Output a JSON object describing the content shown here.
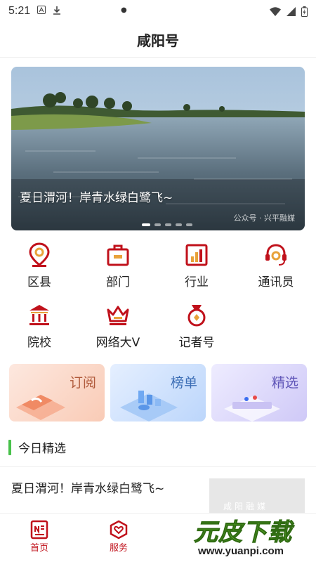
{
  "status_bar": {
    "time": "5:21"
  },
  "header": {
    "title": "咸阳号"
  },
  "banner": {
    "caption": "夏日渭河！岸青水绿白鹭飞~",
    "source_watermark": "公众号 · 兴平融媒",
    "page_count": 5,
    "active_page": 1
  },
  "categories": [
    {
      "label": "区县",
      "icon": "location-pin-icon"
    },
    {
      "label": "部门",
      "icon": "briefcase-icon"
    },
    {
      "label": "行业",
      "icon": "bar-chart-icon"
    },
    {
      "label": "通讯员",
      "icon": "headset-icon"
    },
    {
      "label": "院校",
      "icon": "institution-icon"
    },
    {
      "label": "网络大V",
      "icon": "crown-icon"
    },
    {
      "label": "记者号",
      "icon": "medal-icon"
    }
  ],
  "feature_cards": [
    {
      "label": "订阅",
      "color": "#f4a58a"
    },
    {
      "label": "榜单",
      "color": "#6fa8f2"
    },
    {
      "label": "精选",
      "color": "#a89ef0"
    }
  ],
  "today": {
    "section_title": "今日精选",
    "items": [
      {
        "title": "夏日渭河！岸青水绿白鹭飞~"
      }
    ]
  },
  "bottom_nav": [
    {
      "label": "首页",
      "icon": "news-home-icon",
      "active": true
    },
    {
      "label": "服务",
      "icon": "heart-service-icon",
      "active": false
    }
  ],
  "overlay_logo": {
    "text": "元皮下载",
    "url": "www.yuanpi.com"
  },
  "colors": {
    "brand_red": "#c0111b",
    "accent_green": "#47c14a"
  }
}
